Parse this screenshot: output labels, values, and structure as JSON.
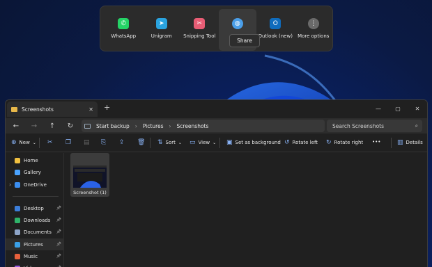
{
  "share": {
    "apps": [
      {
        "label": "WhatsApp",
        "icon": "whatsapp-icon",
        "color": "#25d366",
        "glyph": "✆"
      },
      {
        "label": "Unigram",
        "icon": "telegram-icon",
        "color": "#2aa3df",
        "glyph": "➤"
      },
      {
        "label": "Snipping Tool",
        "icon": "snipping-tool-icon",
        "color": "#e85d75",
        "glyph": "✂"
      },
      {
        "label": "",
        "icon": "globe-icon",
        "color": "#4a9ee8",
        "glyph": "◍"
      },
      {
        "label": "Outlook (new)",
        "icon": "outlook-icon",
        "color": "#0f6cbd",
        "glyph": "O"
      },
      {
        "label": "More options",
        "icon": "more-options-icon",
        "color": "#6a6a6a",
        "glyph": "⋮"
      }
    ],
    "tooltip": "Share"
  },
  "window": {
    "tab_title": "Screenshots",
    "address": [
      "Start backup",
      "Pictures",
      "Screenshots"
    ],
    "search_placeholder": "Search Screenshots",
    "commands": {
      "new": "New",
      "sort": "Sort",
      "view": "View",
      "set_background": "Set as background",
      "rotate_left": "Rotate left",
      "rotate_right": "Rotate right",
      "more": "•••",
      "details": "Details"
    },
    "nav_items": [
      {
        "label": "Home",
        "icon": "home-icon",
        "color": "#f0c040",
        "pinned": false
      },
      {
        "label": "Gallery",
        "icon": "gallery-icon",
        "color": "#4aa3ff",
        "pinned": false
      },
      {
        "label": "OneDrive",
        "icon": "onedrive-icon",
        "color": "#3b8ef0",
        "pinned": false
      },
      {
        "label": "Desktop",
        "icon": "desktop-icon",
        "color": "#3c7ed9",
        "pinned": true
      },
      {
        "label": "Downloads",
        "icon": "downloads-icon",
        "color": "#2fb36a",
        "pinned": true
      },
      {
        "label": "Documents",
        "icon": "documents-icon",
        "color": "#8ea5c8",
        "pinned": true
      },
      {
        "label": "Pictures",
        "icon": "pictures-icon",
        "color": "#3aa0e8",
        "pinned": true
      },
      {
        "label": "Music",
        "icon": "music-icon",
        "color": "#e8603c",
        "pinned": true
      },
      {
        "label": "Videos",
        "icon": "videos-icon",
        "color": "#9a5ae0",
        "pinned": true
      }
    ],
    "files": [
      {
        "name": "Screenshot (1)"
      }
    ]
  }
}
